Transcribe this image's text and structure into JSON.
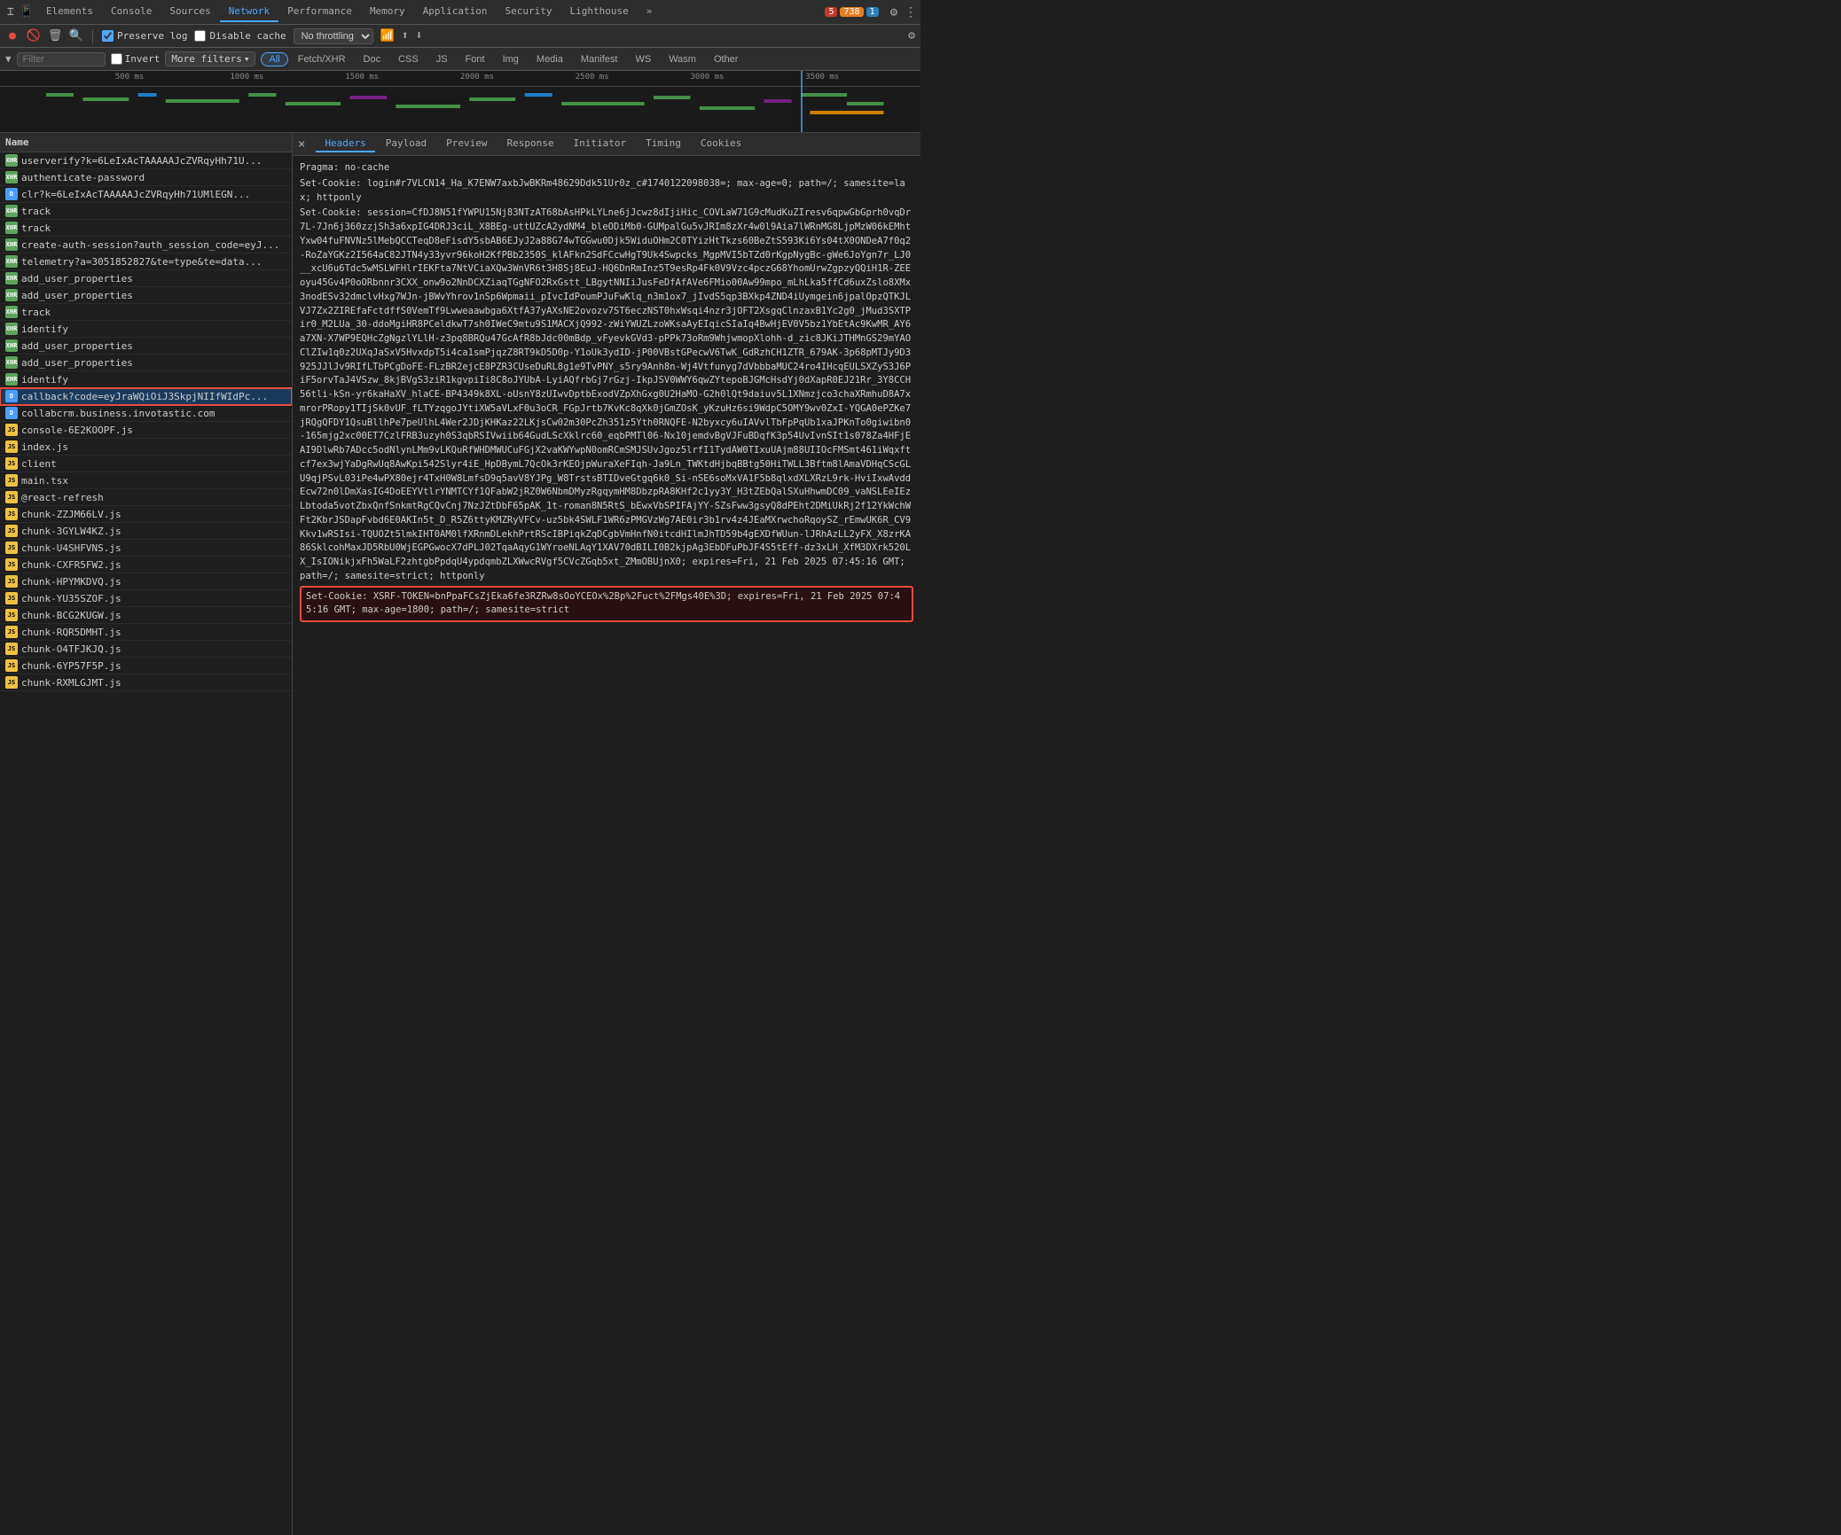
{
  "tabs": {
    "items": [
      {
        "label": "Elements",
        "active": false
      },
      {
        "label": "Console",
        "active": false
      },
      {
        "label": "Sources",
        "active": false
      },
      {
        "label": "Network",
        "active": true
      },
      {
        "label": "Performance",
        "active": false
      },
      {
        "label": "Memory",
        "active": false
      },
      {
        "label": "Application",
        "active": false
      },
      {
        "label": "Security",
        "active": false
      },
      {
        "label": "Lighthouse",
        "active": false
      }
    ],
    "more_label": "»"
  },
  "toolbar": {
    "preserve_log_label": "Preserve log",
    "disable_cache_label": "Disable cache",
    "throttle_value": "No throttling",
    "invert_label": "Invert",
    "filter_label": "Filter",
    "more_filters_label": "More filters"
  },
  "filter_buttons": [
    {
      "label": "All",
      "active": true
    },
    {
      "label": "Fetch/XHR",
      "active": false
    },
    {
      "label": "Doc",
      "active": false
    },
    {
      "label": "CSS",
      "active": false
    },
    {
      "label": "JS",
      "active": false
    },
    {
      "label": "Font",
      "active": false
    },
    {
      "label": "Img",
      "active": false
    },
    {
      "label": "Media",
      "active": false
    },
    {
      "label": "Manifest",
      "active": false
    },
    {
      "label": "WS",
      "active": false
    },
    {
      "label": "Wasm",
      "active": false
    },
    {
      "label": "Other",
      "active": false
    }
  ],
  "timeline": {
    "ticks": [
      "500 ms",
      "1000 ms",
      "1500 ms",
      "2000 ms",
      "2500 ms",
      "3000 ms",
      "3500 ms"
    ]
  },
  "request_list": {
    "header": "Name",
    "items": [
      {
        "name": "userverify?k=6LeIxAcTAAAAAJcZVRqyHh71U...",
        "type": "xhr",
        "icon": "xhr"
      },
      {
        "name": "authenticate-password",
        "type": "xhr",
        "icon": "xhr"
      },
      {
        "name": "clr?k=6LeIxAcTAAAAAJcZVRqyHh71UMlEGN...",
        "type": "doc",
        "icon": "doc"
      },
      {
        "name": "track",
        "type": "xhr",
        "icon": "xhr"
      },
      {
        "name": "track",
        "type": "xhr",
        "icon": "xhr"
      },
      {
        "name": "create-auth-session?auth_session_code=eyJ...",
        "type": "xhr",
        "icon": "xhr"
      },
      {
        "name": "telemetry?a=3051852827&te=type&te=data...",
        "type": "xhr",
        "icon": "xhr"
      },
      {
        "name": "add_user_properties",
        "type": "xhr",
        "icon": "xhr"
      },
      {
        "name": "add_user_properties",
        "type": "xhr",
        "icon": "xhr"
      },
      {
        "name": "track",
        "type": "xhr",
        "icon": "xhr"
      },
      {
        "name": "identify",
        "type": "xhr",
        "icon": "xhr"
      },
      {
        "name": "add_user_properties",
        "type": "xhr",
        "icon": "xhr"
      },
      {
        "name": "add_user_properties",
        "type": "xhr",
        "icon": "xhr"
      },
      {
        "name": "identify",
        "type": "xhr",
        "icon": "xhr"
      },
      {
        "name": "callback?code=eyJraWQiOiJ3SkpjNIIfWIdPc...",
        "type": "doc",
        "icon": "doc",
        "selected": true,
        "highlighted": true
      },
      {
        "name": "collabcrm.business.invotastic.com",
        "type": "doc",
        "icon": "doc"
      },
      {
        "name": "console-6E2KOOPF.js",
        "type": "js",
        "icon": "js"
      },
      {
        "name": "index.js",
        "type": "js",
        "icon": "js"
      },
      {
        "name": "client",
        "type": "js",
        "icon": "js"
      },
      {
        "name": "main.tsx",
        "type": "js",
        "icon": "js"
      },
      {
        "name": "@react-refresh",
        "type": "js",
        "icon": "js"
      },
      {
        "name": "chunk-ZZJM66LV.js",
        "type": "js",
        "icon": "js"
      },
      {
        "name": "chunk-3GYLW4KZ.js",
        "type": "js",
        "icon": "js"
      },
      {
        "name": "chunk-U4SHFVNS.js",
        "type": "js",
        "icon": "js"
      },
      {
        "name": "chunk-CXFR5FW2.js",
        "type": "js",
        "icon": "js"
      },
      {
        "name": "chunk-HPYMKDVQ.js",
        "type": "js",
        "icon": "js"
      },
      {
        "name": "chunk-YU35SZOF.js",
        "type": "js",
        "icon": "js"
      },
      {
        "name": "chunk-BCG2KUGW.js",
        "type": "js",
        "icon": "js"
      },
      {
        "name": "chunk-RQR5DMHT.js",
        "type": "js",
        "icon": "js"
      },
      {
        "name": "chunk-O4TFJKJQ.js",
        "type": "js",
        "icon": "js"
      },
      {
        "name": "chunk-6YP57F5P.js",
        "type": "js",
        "icon": "js"
      },
      {
        "name": "chunk-RXMLGJMT.js",
        "type": "js",
        "icon": "js"
      }
    ]
  },
  "detail_panel": {
    "close_label": "×",
    "tabs": [
      {
        "label": "Headers",
        "active": true
      },
      {
        "label": "Payload",
        "active": false
      },
      {
        "label": "Preview",
        "active": false
      },
      {
        "label": "Response",
        "active": false
      },
      {
        "label": "Initiator",
        "active": false
      },
      {
        "label": "Timing",
        "active": false
      },
      {
        "label": "Cookies",
        "active": false
      }
    ],
    "content": [
      "Pragma: no-cache",
      "Set-Cookie: login#r7VLCN14_Ha_K7ENW7axbJwBKRm48629Ddk51Ur0z_c#1740122098038=; max-age=0; path=/; samesite=lax; httponly",
      "Set-Cookie: session=CfDJ8N51fYWPU15Nj83NTzAT68bAsHPkLYLne6jJcwz8dIjiHic_COVLaW71G9cMudKuZIresv6qpwGbGprh0vqDr7L-7Jn6j360zzjSh3a6xpIG4DRJ3ciL_X8BEg-uttUZcA2ydNM4_bleODiMb0-GUMpalGu5vJRIm8zXr4w0l9Aia7lWRnMG8LjpMzW06kEMhtYxw04fuFNVNz5lMebQCCTeqD8eFisdY5sbAB6EJyJ2a88G74wTGGwu0Djk5WiduOHm2C0TYizHtTkzs60BeZtS593Ki6Ys04tX0ONDeA7f0q2-RoZaYGKz2I564aC82JTN4y33yvr96koH2KfPBb2350S_klAFkn2SdFCcwHgT9Uk4Swpcks_MgpMVI5bTZd0rKgpNygBc-gWe6JoYgn7r_LJ0__xcU6u6Tdc5wMSLWFHlrIEKFta7NtVCiaXQw3WnVR6t3H8Sj8EuJ-HQ6DnRmInz5T9esRp4Fk0V9Vzc4pczG68YhomUrwZgpzyQQiH1R-ZEEoyu45Gv4P0oORbnnr3CXX_onw9o2NnDCXZiaqTGgNFO2RxGstt_LBgytNNIiJusFeDfAfAVe6FMio00Aw99mpo_mLhLka5ffCd6uxZslo8XMx3nodESv32dmclvHxg7WJn-jBWvYhrov1nSp6Wpmaii_pIvcIdPoumPJuFwKlq_n3m1ox7_jIvdS5qp3BXkp4ZND4iUymgein6jpalOpzQTKJLVJ7Zx2ZIREfaFctdffS0VemTf9Lwweaawbga6XtfA37yAXsNE2ovozv7ST6eczNST0hxWsqi4nzr3jOFT2XsgqClnzaxB1Yc2g0_jMud3SXTPir0_M2LUa_30-ddoMgiHR8PCeldkwT7sh0IWeC9mtu9S1MACXjQ992-zWiYWUZLzoWKsaAyEIqicSIaIq4BwHjEV0V5bz1YbEtAc9KwMR_AY6a7XN-X7WP9EQHcZgNgzlYLlH-z3pq8BRQu47GcAfR8bJdc00mBdp_vFyevkGVd3-pPPk73oRm9WhjwmopXlohh-d_zic8JKiJTHMnGS29mYAOClZIw1q0z2UXqJaSxV5HvxdpT5i4ca1smPjqzZ8RT9kD5D0p-Y1oUk3ydID-jP00VBstGPecwV6TwK_GdRzhCH1ZTR_679AK-3p68pMTJy9D3925JJlJv9RIfLTbPCgDoFE-FLzBR2ejcE8PZR3CUseDuRL8g1e9TvPNY_s5ry9Anh8n-Wj4Vtfunyg7dVbbbaMUC24ro4IHcqEULSXZyS3J6PiF5orvTaJ4VSzw_8kjBVgS3ziR1kgvpiIi8C8oJYUbA-LyiAQfrbGj7rGzj-IkpJSV0WWY6qwZYtepoBJGMcHsdYj0dXapR0EJ21Rr_3Y8CCH56tli-kSn-yr6kaHaXV_hlaCE-BP4349k8XL-oUsnY8zUIwvDptbExodVZpXhGxg0U2HaMO-G2h0lQt9daiuv5L1XNmzjco3chaXRmhuD8A7xmrorPRopy1TIjSk0vUF_fLTYzqgoJYtiXW5aVLxF0u3oCR_FGpJrtb7KvKc8qXk0jGmZOsK_yKzuHz6si9WdpC5OMY9wv0ZxI-YQGA0ePZKe7jRQgQFDY1QsuBllhPe7peUlhL4Wer2JDjKHKaz22LKjsCw02m30PcZh351z5Yth0RNQFE-N2byxcy6uIAVvlTbFpPqUb1xaJPKnTo0giwibn0-165mjg2xc00ET7CzlFRB3uzyh0S3qbRSIVwiib64GudLScXklrc60_eqbPMTl06-Nx10jemdvBgVJFuBDqfK3p54UvIvnSIt1s078Za4HFjEAI9DlwRb7ADcc5odNlynLMm9vLKQuRfWHDMWUCuFGjX2vaKWYwpN0omRCmSMJSUvJgoz5lrfI1TydAW0TIxuUAjm88UIIOcFMSmt461iWqxftcf7ex3wjYaDgRwUq8AwKpi542Slyr4iE_HpDBymL7QcOk3rKEOjpWuraXeFIqh-Ja9Ln_TWKtdHjbqBBtg50HiTWLL3Bftm8lAmaVDHqCScGLU9qjPSvL03iPe4wPX80ejr4TxH0W8LmfsD9q5avV8YJPg_W8TrstsBTIDveGtgq6k0_Si-nSE6soMxVA1F5b8qlxdXLXRzL9rk-HviIxwAvddEcw72n0lDmXasIG4DoEEYVtlrYNMTCYf1QFabW2jRZ0W6NbmDMyzRgqymHM8DbzpRA8KHf2c1yy3Y_H3tZEbQalSXuHhwmDC09_vaNSLEeIEzLbtoda5votZbxQnfSnkmtRgCQvCnj7NzJZtDbF65pAK_1t-roman8N5RtS_bEwxVbSPIFAjYY-SZsFww3gsyQ8dPEht2DMiUkRj2f12YkWchWFt2KbrJSDapFvbd6E0AKIn5t_D_R5Z6ttyKMZRyVFCv-uz5bk4SWLF1WR6zPMGVzWg7AE0ir3b1rv4z4JEaMXrwchoRqoySZ_rEmwUK6R_CV9Kkv1wRSIsi-TQUOZt5lmkIHT0AM0lfXRnmDLekhPrtRScIBPiqkZqDCgbVmHnfN0itcdHIlmJhTD59b4gEXDfWUun-lJRhAzLL2yFX_X8zrKA86SklcohMaxJD5RbU0WjEGPGwocX7dPLJ02TqaAqyG1WYroeNLAqY1XAV70dBILI0B2kjpAg3EbDFuPbJF4S5tEff-dz3xLH_XfM3DXrk520LX_IsIONikjxFh5WaLF2zhtgbPpdqU4ypdqmbZLXWwcRVgf5CVcZGqb5xt_ZMmOBUjnX0; expires=Fri, 21 Feb 2025 07:45:16 GMT; path=/; samesite=strict; httponly",
      "Set-Cookie: XSRF-TOKEN=bnPpaFCsZjEka6fe3RZRw8sOoYCEOx%2Bp%2Fuct%2FMgs40E%3D; expires=Fri, 21 Feb 2025 07:45:16 GMT; max-age=1800; path=/; samesite=strict"
    ]
  },
  "badges": {
    "error_count": "5",
    "warn_count": "738",
    "info_count": "1"
  },
  "icons": {
    "record": "⏺",
    "stop": "⏹",
    "clear": "🚫",
    "search": "🔍",
    "settings": "⚙",
    "more": "⋮",
    "close": "×",
    "upload": "⬆",
    "download": "⬇",
    "wifi": "📶",
    "chevron_down": "▾"
  }
}
